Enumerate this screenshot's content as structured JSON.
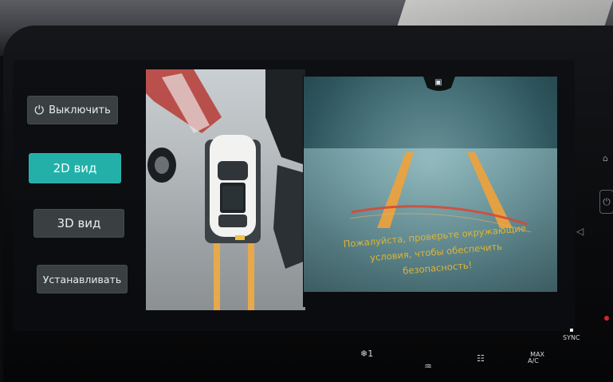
{
  "buttons": {
    "power_off": "Выключить",
    "view_2d": "2D вид",
    "view_3d": "3D вид",
    "settings": "Устанавливать"
  },
  "warning_lines": [
    "Пожалуйста, проверьте окружающие",
    "условия, чтобы обеспечить",
    "безопасность!"
  ],
  "bottom_controls": {
    "fan": "1",
    "max_ac": "MAX\nA/C",
    "sync": "SYNC"
  },
  "icons": {
    "power": "power-icon",
    "camera": "camera-icon",
    "volume": "volume-icon",
    "home": "home-icon",
    "fan": "fan-icon",
    "defrost_front": "front-defrost-icon",
    "defrost_rear": "rear-defrost-icon"
  },
  "colors": {
    "active_button": "#22b0a9",
    "button": "#3a4042",
    "warning_text": "#e0b436",
    "guide_lines": "#f0a23a"
  }
}
